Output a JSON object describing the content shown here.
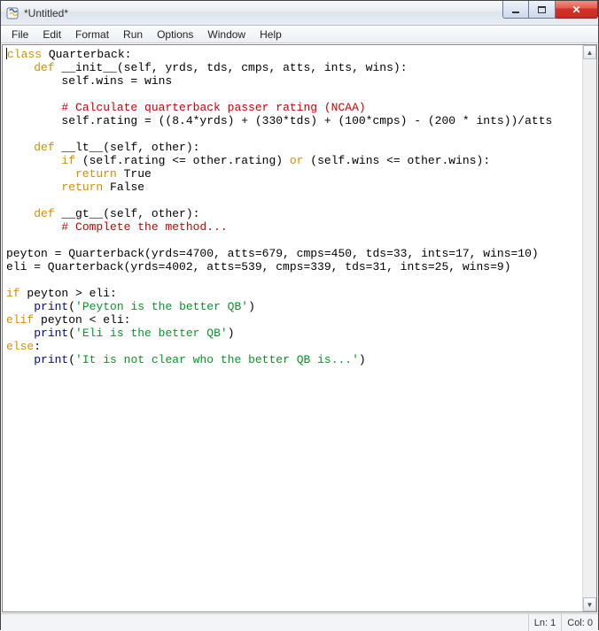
{
  "window": {
    "title": "*Untitled*"
  },
  "menus": [
    "File",
    "Edit",
    "Format",
    "Run",
    "Options",
    "Window",
    "Help"
  ],
  "status": {
    "line": "Ln: 1",
    "col": "Col: 0"
  },
  "code": {
    "l01_a": "class",
    "l01_b": " Quarterback:",
    "l02_a": "    ",
    "l02_b": "def",
    "l02_c": " __init__(self, yrds, tds, cmps, atts, ints, wins):",
    "l03": "        self.wins = wins",
    "l04": "",
    "l05_a": "        ",
    "l05_b": "# Calculate quarterback passer rating (NCAA)",
    "l06": "        self.rating = ((8.4*yrds) + (330*tds) + (100*cmps) - (200 * ints))/atts",
    "l07": "",
    "l08_a": "    ",
    "l08_b": "def",
    "l08_c": " __lt__(self, other):",
    "l09_a": "        ",
    "l09_b": "if",
    "l09_c": " (self.rating <= other.rating) ",
    "l09_d": "or",
    "l09_e": " (self.wins <= other.wins):",
    "l10_a": "          ",
    "l10_b": "return",
    "l10_c": " True",
    "l11_a": "        ",
    "l11_b": "return",
    "l11_c": " False",
    "l12": "",
    "l13_a": "    ",
    "l13_b": "def",
    "l13_c": " __gt__(self, other):",
    "l14_a": "        ",
    "l14_b": "# Complete the method...",
    "l15": "",
    "l16": "peyton = Quarterback(yrds=4700, atts=679, cmps=450, tds=33, ints=17, wins=10)",
    "l17": "eli = Quarterback(yrds=4002, atts=539, cmps=339, tds=31, ints=25, wins=9)",
    "l18": "",
    "l19_a": "if",
    "l19_b": " peyton > eli:",
    "l20_a": "    ",
    "l20_b": "print",
    "l20_c": "(",
    "l20_d": "'Peyton is the better QB'",
    "l20_e": ")",
    "l21_a": "elif",
    "l21_b": " peyton < eli:",
    "l22_a": "    ",
    "l22_b": "print",
    "l22_c": "(",
    "l22_d": "'Eli is the better QB'",
    "l22_e": ")",
    "l23_a": "else",
    "l23_b": ":",
    "l24_a": "    ",
    "l24_b": "print",
    "l24_c": "(",
    "l24_d": "'It is not clear who the better QB is...'",
    "l24_e": ")"
  }
}
